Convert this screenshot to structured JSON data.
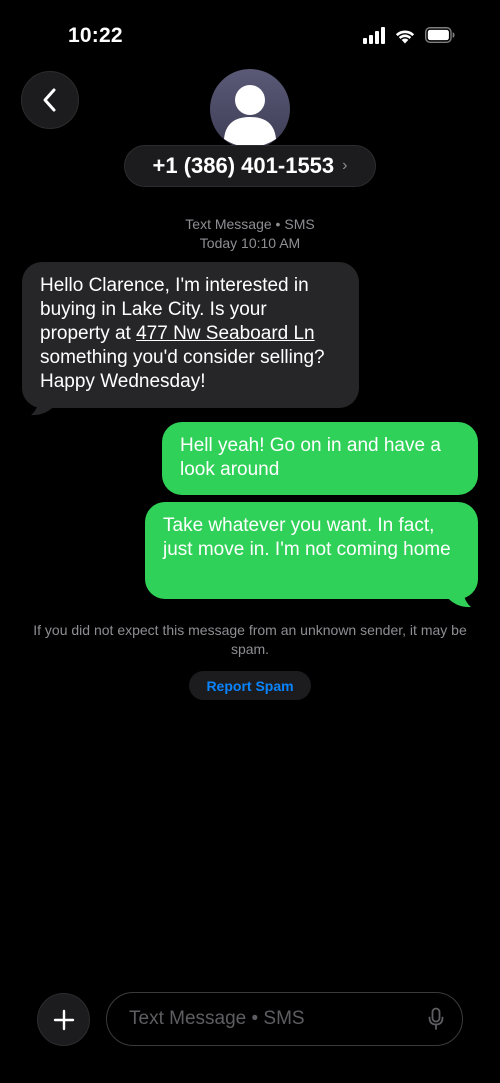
{
  "status_bar": {
    "time": "10:22"
  },
  "header": {
    "contact_number": "+1 (386) 401-1553",
    "chevron": "›"
  },
  "thread": {
    "service_label": "Text Message • SMS",
    "timestamp": "Today 10:10 AM",
    "incoming": {
      "text_before_link": "Hello Clarence, I'm interested in buying in Lake City. Is your property at ",
      "link_text": "477 Nw Seaboard Ln",
      "text_after_link": " something you'd consider selling? Happy Wednesday!"
    },
    "outgoing": [
      "Hell yeah! Go on in and have a look around",
      "Take whatever you want. In fact, just move in. I'm not coming home"
    ],
    "spam_notice": "If you did not expect this message from an unknown sender, it may be spam.",
    "report_spam_label": "Report Spam"
  },
  "composer": {
    "placeholder": "Text Message • SMS"
  },
  "colors": {
    "background": "#000000",
    "incoming_bubble": "#262628",
    "outgoing_bubble": "#30d158",
    "link_blue": "#0a84ff",
    "secondary_text": "#8e8e93"
  },
  "icons": {
    "back": "chevron-left-icon",
    "avatar": "person-icon",
    "plus": "plus-icon",
    "mic": "microphone-icon",
    "signal": "cellular-signal-icon",
    "wifi": "wifi-icon",
    "battery": "battery-icon"
  }
}
